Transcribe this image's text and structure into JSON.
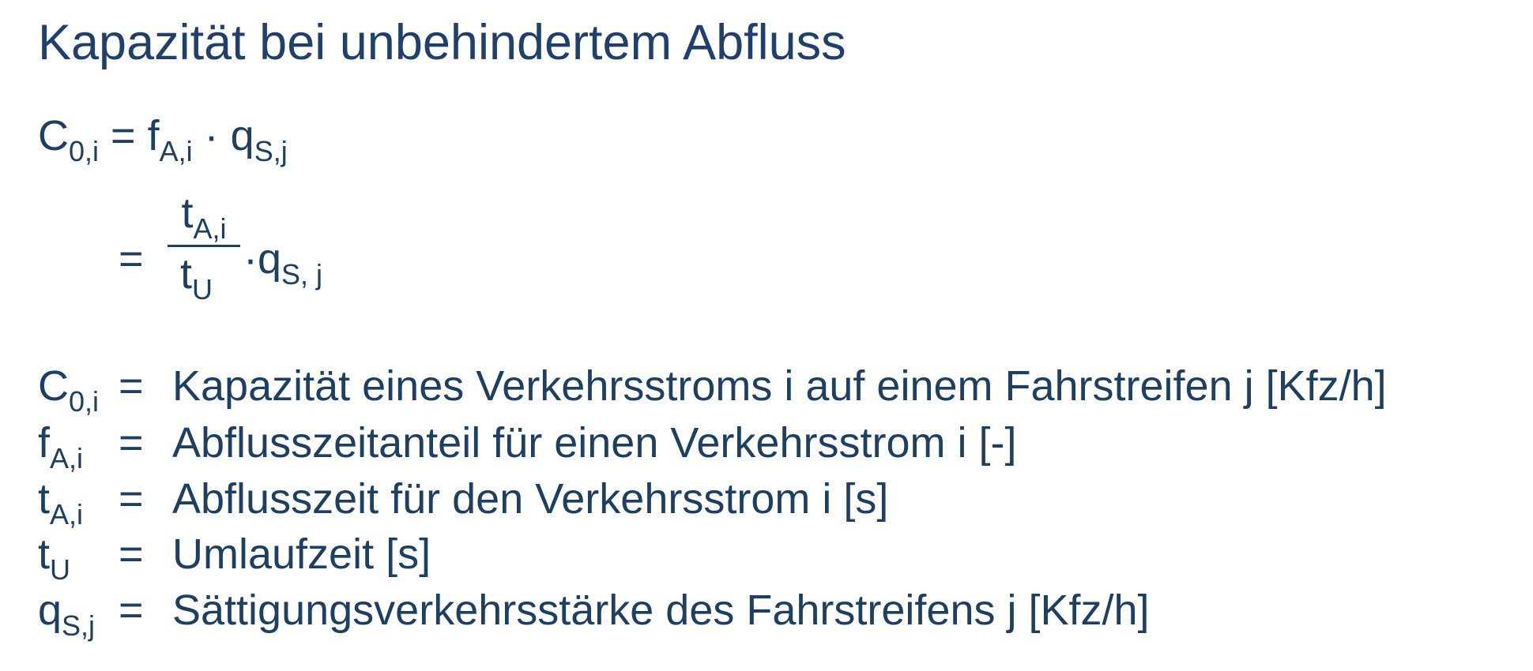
{
  "title": "Kapazität bei unbehindertem Abfluss",
  "formula1": {
    "lhs": "C",
    "lhs_sub": "0,i",
    "eq": "=",
    "t1": "f",
    "t1_sub": "A,i",
    "op": "·",
    "t2": "q",
    "t2_sub": "S,j"
  },
  "formula2": {
    "eq": "=",
    "num": "t",
    "num_sub": "A,i",
    "den": "t",
    "den_sub": "U",
    "op": "·",
    "t2": "q",
    "t2_sub": "S, j"
  },
  "definitions": [
    {
      "sym": "C",
      "sub": "0,i",
      "eq": "=",
      "desc": "Kapazität eines Verkehrsstroms i auf einem Fahrstreifen j [Kfz/h]"
    },
    {
      "sym": "f",
      "sub": "A,i",
      "eq": "=",
      "desc": "Abflusszeitanteil  für einen Verkehrsstrom i [-]"
    },
    {
      "sym": "t",
      "sub": "A,i",
      "eq": "=",
      "desc": "Abflusszeit für den Verkehrsstrom i [s]"
    },
    {
      "sym": "t",
      "sub": "U",
      "eq": "=",
      "desc": "Umlaufzeit [s]"
    },
    {
      "sym": "q",
      "sub": "S,j",
      "eq": "=",
      "desc": "Sättigungsverkehrsstärke des Fahrstreifens j [Kfz/h]"
    }
  ]
}
